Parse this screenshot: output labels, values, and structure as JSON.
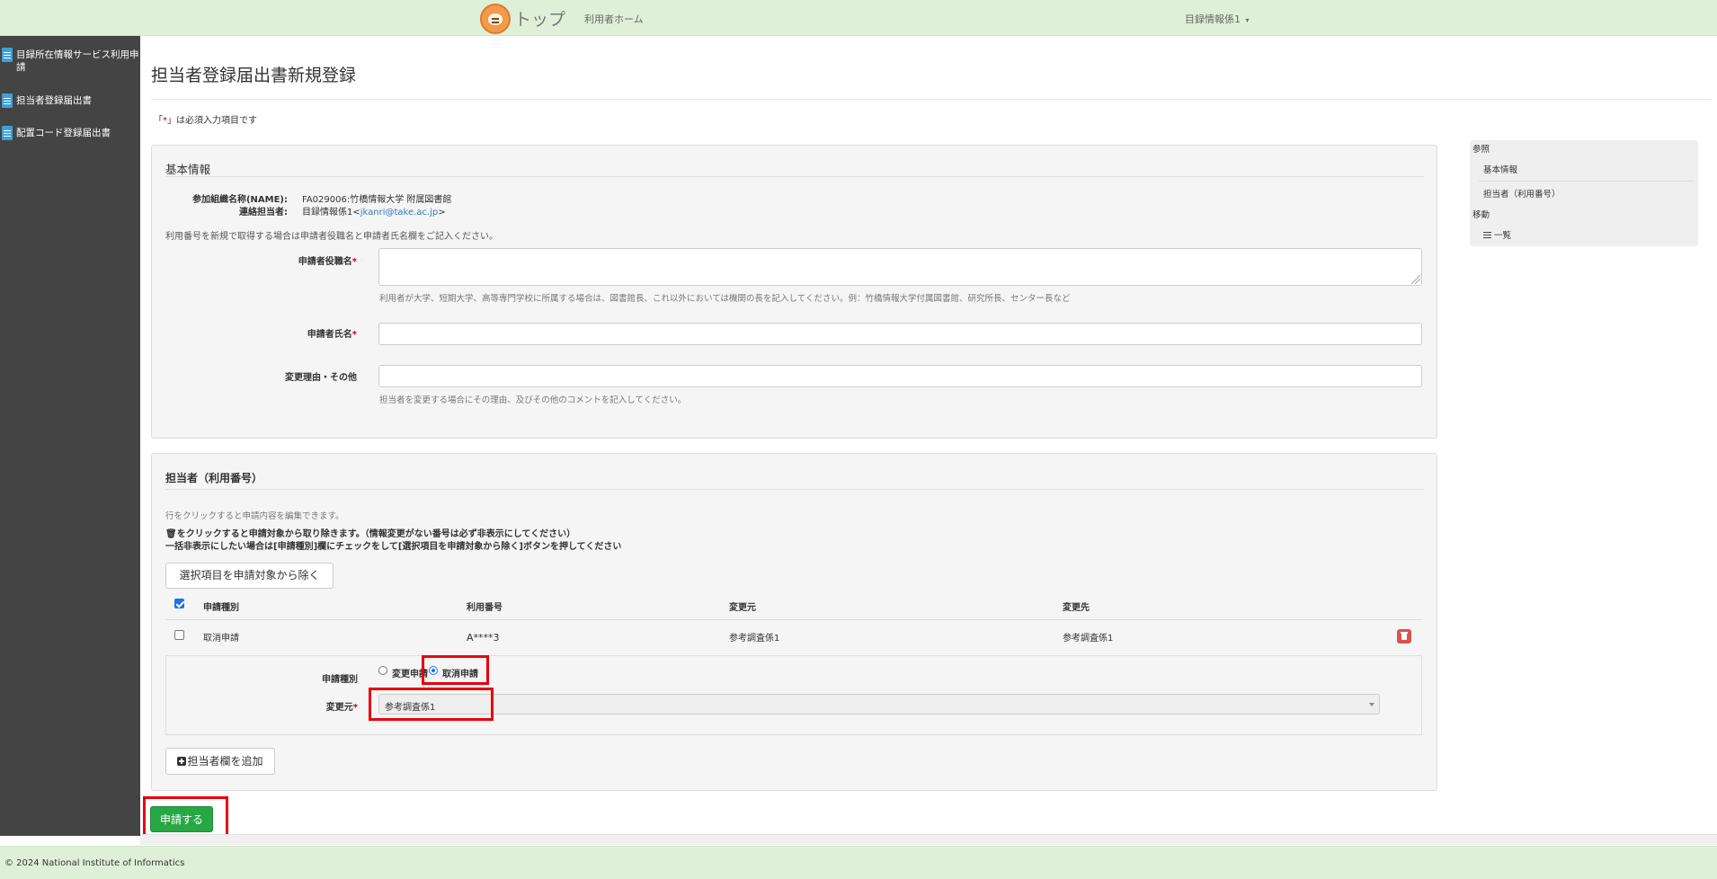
{
  "header": {
    "brand": "トップ",
    "nav_home": "利用者ホーム",
    "user_menu": "目録情報係1",
    "user_caret": "▾"
  },
  "sidebar": {
    "items": [
      {
        "label": "目録所在情報サービス利用申請"
      },
      {
        "label": "担当者登録届出書"
      },
      {
        "label": "配置コード登録届出書"
      }
    ]
  },
  "page": {
    "title": "担当者登録届出書新規登録",
    "required_note_prefix": "「",
    "required_note_star": "*",
    "required_note_suffix": "」は必須入力項目です"
  },
  "basic_info": {
    "title": "基本情報",
    "org_label": "参加組織名称(NAME):",
    "org_value": "FA029006:竹橋情報大学 附属図書館",
    "contact_label": "連絡担当者:",
    "contact_name": "目録情報係1<",
    "contact_email": "jkanri@take.ac.jp",
    "contact_close": ">",
    "intro_note": "利用番号を新規で取得する場合は申請者役職名と申請者氏名欄をご記入ください。",
    "fields": {
      "applicant_title_label": "申請者役職名",
      "applicant_title_value": "",
      "applicant_title_hint": "利用者が大学、短期大学、高等専門学校に所属する場合は、図書館長、これ以外においては機関の長を記入してください。例：竹橋情報大学付属図書館、研究所長、センター長など",
      "applicant_name_label": "申請者氏名",
      "applicant_name_value": "",
      "change_reason_label": "変更理由・その他",
      "change_reason_value": "",
      "change_reason_hint": "担当者を変更する場合にその理由、及びその他のコメントを記入してください。"
    },
    "required_star": "*"
  },
  "staff": {
    "title": "担当者（利用番号）",
    "note_click": "行をクリックすると申請内容を編集できます。",
    "note_trash": "🗑をクリックすると申請対象から取り除きます。（情報変更がない番号は必ず非表示にしてください）",
    "note_bulk": "一括非表示にしたい場合は[申請種別]欄にチェックをして[選択項目を申請対象から除く]ボタンを押してください",
    "exclude_button": "選択項目を申請対象から除く",
    "columns": [
      "申請種別",
      "利用番号",
      "変更元",
      "変更先"
    ],
    "header_checkbox_checked": true,
    "rows": [
      {
        "checked": false,
        "type": "取消申請",
        "number": "A****3",
        "from": "参考調査係1",
        "to": "参考調査係1"
      }
    ],
    "detail": {
      "type_label": "申請種別",
      "option_change": "変更申請",
      "option_cancel": "取消申請",
      "selected": "取消申請",
      "from_label": "変更元",
      "from_value": "参考調査係1",
      "required_star": "*"
    },
    "add_button": "担当者欄を追加"
  },
  "submit_button": "申請する",
  "right_nav": {
    "ref_heading": "参照",
    "ref_items": [
      "基本情報",
      "担当者（利用番号）"
    ],
    "move_heading": "移動",
    "move_items": [
      "一覧"
    ]
  },
  "footer": {
    "copyright": "© 2024 National Institute of Informatics"
  },
  "colors": {
    "header_bg": "#dff0d8",
    "sidebar_bg": "#444444",
    "submit_bg": "#28a745",
    "highlight_red": "#e8000b",
    "delete_red": "#d9534f",
    "link": "#337ab7"
  }
}
